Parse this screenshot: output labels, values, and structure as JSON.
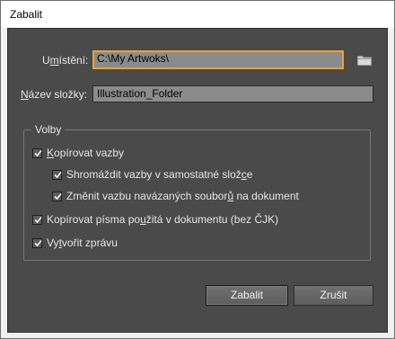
{
  "window": {
    "title": "Zabalit"
  },
  "location": {
    "label_pre": "U",
    "label_mnemonic": "m",
    "label_post": "ístění:",
    "value": "C:\\My Artwoks\\",
    "browse_icon": "folder-icon"
  },
  "folder_name": {
    "label_mnemonic": "N",
    "label_post": "ázev složky:",
    "value": "Illustration_Folder"
  },
  "options": {
    "group_label": "Volby",
    "items": [
      {
        "pre": "",
        "mnemonic": "K",
        "post": "opírovat vazby",
        "checked": true
      },
      {
        "pre": "Shromáždit vazby v samostatné slož",
        "mnemonic": "c",
        "post": "e",
        "checked": true
      },
      {
        "pre": "Změnit vazbu navázaných soubor",
        "mnemonic": "ů",
        "post": " na dokument",
        "checked": true
      },
      {
        "pre": "Kopírovat písma po",
        "mnemonic": "u",
        "post": "žitá v dokumentu (bez ČJK)",
        "checked": true
      },
      {
        "pre": "Vy",
        "mnemonic": "t",
        "post": "vořit zprávu",
        "checked": true
      }
    ]
  },
  "buttons": {
    "ok": "Zabalit",
    "cancel": "Zrušit"
  },
  "colors": {
    "dialog_bg": "#4a4a4a",
    "field_bg": "#8b8b8b",
    "focus_ring": "#f0a030"
  }
}
